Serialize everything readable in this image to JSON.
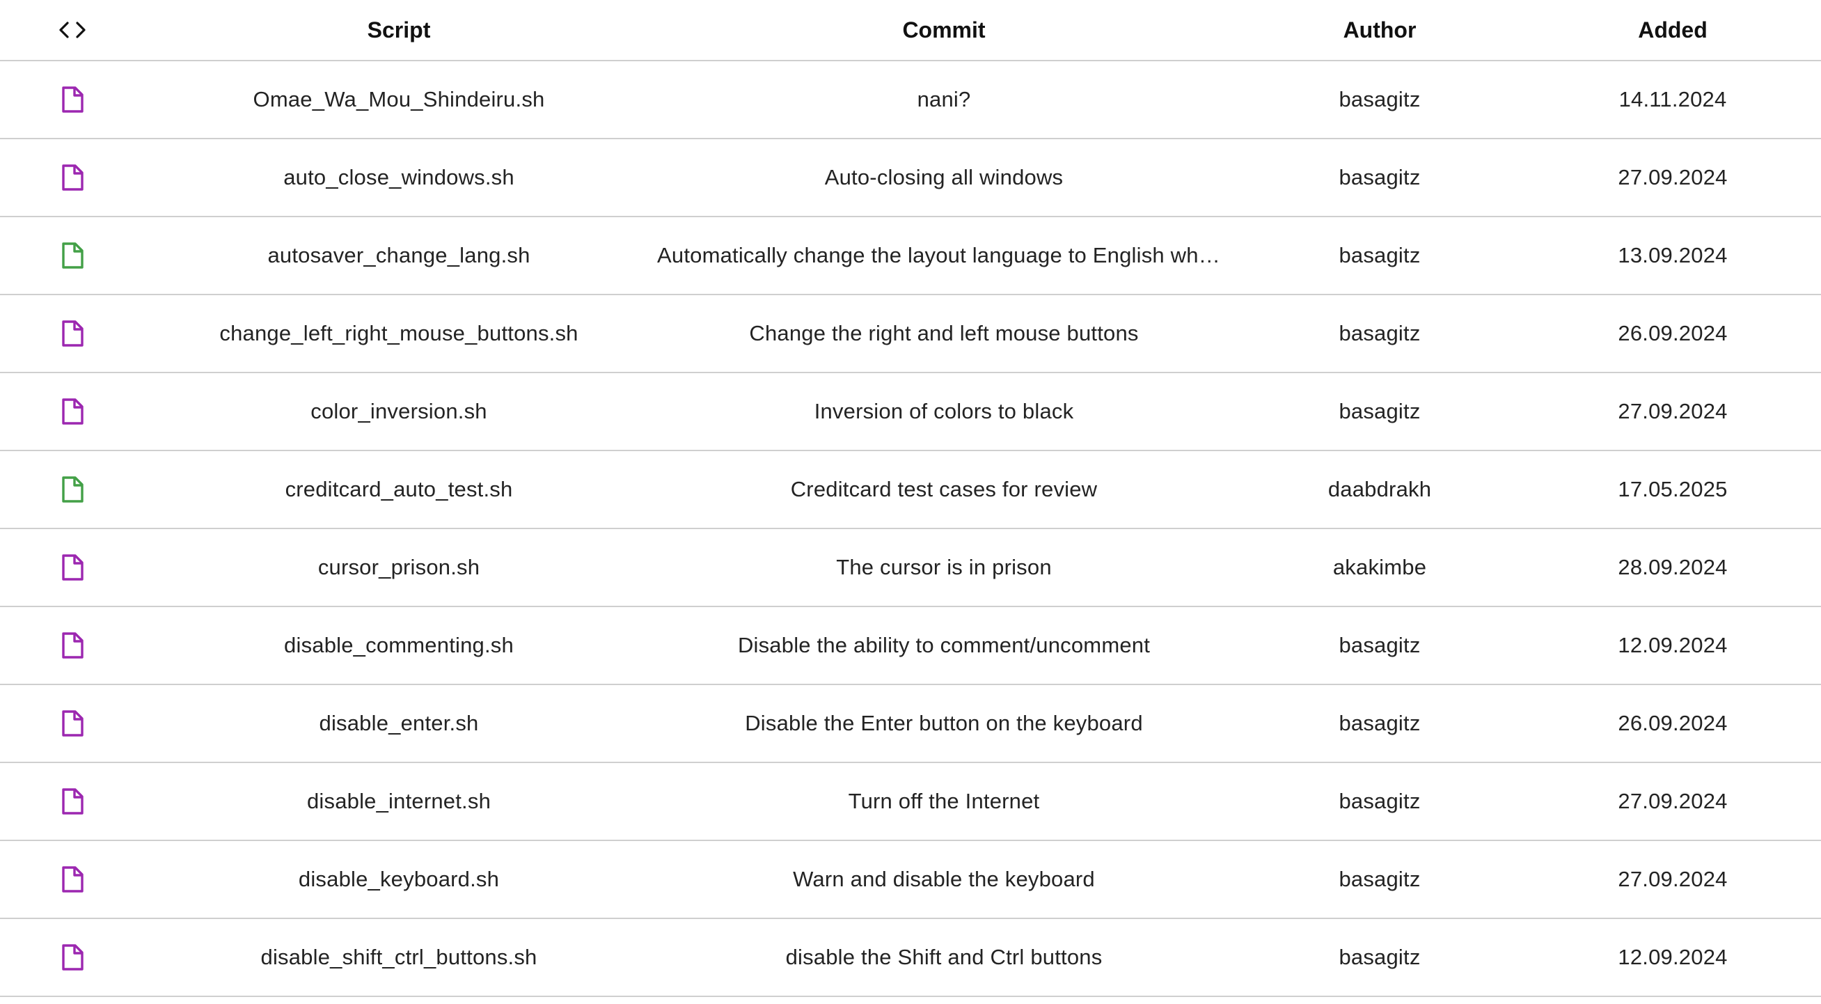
{
  "header": {
    "code_icon": "code-brackets-icon",
    "columns": [
      "Script",
      "Commit",
      "Author",
      "Added"
    ]
  },
  "colors": {
    "file_purple": "#9c27b0",
    "file_green": "#43a047",
    "divider": "#cfcfcf"
  },
  "rows": [
    {
      "icon": "file-icon",
      "icon_color": "purple",
      "script": "Omae_Wa_Mou_Shindeiru.sh",
      "commit": "nani?",
      "author": "basagitz",
      "added": "14.11.2024"
    },
    {
      "icon": "file-icon",
      "icon_color": "purple",
      "script": "auto_close_windows.sh",
      "commit": "Auto-closing all windows",
      "author": "basagitz",
      "added": "27.09.2024"
    },
    {
      "icon": "file-icon",
      "icon_color": "green",
      "script": "autosaver_change_lang.sh",
      "commit": "Automatically change the layout language to English when the …",
      "author": "basagitz",
      "added": "13.09.2024"
    },
    {
      "icon": "file-icon",
      "icon_color": "purple",
      "script": "change_left_right_mouse_buttons.sh",
      "commit": "Change the right and left mouse buttons",
      "author": "basagitz",
      "added": "26.09.2024"
    },
    {
      "icon": "file-icon",
      "icon_color": "purple",
      "script": "color_inversion.sh",
      "commit": "Inversion of colors to black",
      "author": "basagitz",
      "added": "27.09.2024"
    },
    {
      "icon": "file-icon",
      "icon_color": "green",
      "script": "creditcard_auto_test.sh",
      "commit": "Creditcard test cases for review",
      "author": "daabdrakh",
      "added": "17.05.2025"
    },
    {
      "icon": "file-icon",
      "icon_color": "purple",
      "script": "cursor_prison.sh",
      "commit": "The cursor is in prison",
      "author": "akakimbe",
      "added": "28.09.2024"
    },
    {
      "icon": "file-icon",
      "icon_color": "purple",
      "script": "disable_commenting.sh",
      "commit": "Disable the ability to comment/uncomment",
      "author": "basagitz",
      "added": "12.09.2024"
    },
    {
      "icon": "file-icon",
      "icon_color": "purple",
      "script": "disable_enter.sh",
      "commit": "Disable the Enter button on the keyboard",
      "author": "basagitz",
      "added": "26.09.2024"
    },
    {
      "icon": "file-icon",
      "icon_color": "purple",
      "script": "disable_internet.sh",
      "commit": "Turn off the Internet",
      "author": "basagitz",
      "added": "27.09.2024"
    },
    {
      "icon": "file-icon",
      "icon_color": "purple",
      "script": "disable_keyboard.sh",
      "commit": "Warn and disable the keyboard",
      "author": "basagitz",
      "added": "27.09.2024"
    },
    {
      "icon": "file-icon",
      "icon_color": "purple",
      "script": "disable_shift_ctrl_buttons.sh",
      "commit": "disable the Shift and Ctrl buttons",
      "author": "basagitz",
      "added": "12.09.2024"
    }
  ]
}
